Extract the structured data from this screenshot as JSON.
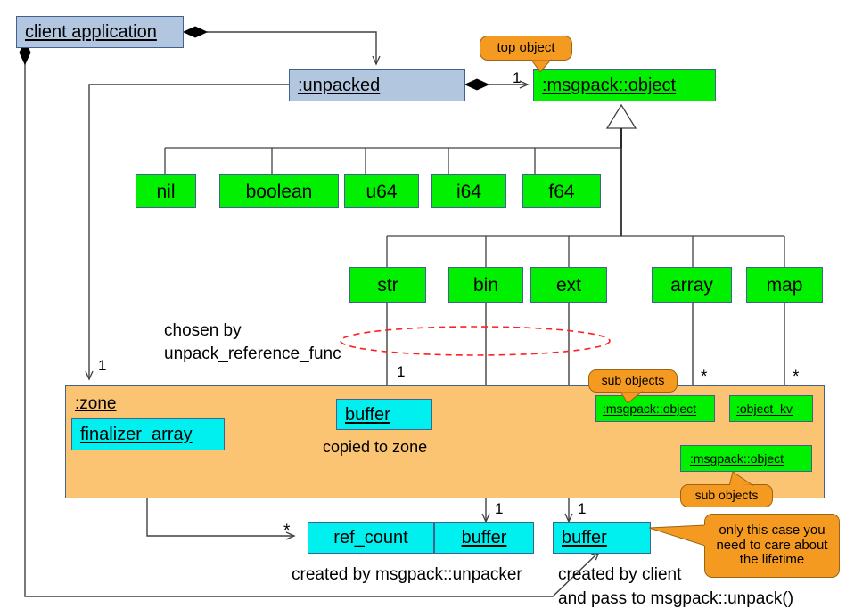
{
  "diagram": {
    "title": "msgpack unpacked object ownership diagram",
    "colors": {
      "client_box": "#b2c6e0",
      "type_box": "#00f000",
      "buffer_box": "#00f0f0",
      "zone_box": "#fac473",
      "callout": "#f59a21",
      "ellipse_hint": "#ff0000",
      "line": "#404040"
    }
  },
  "nodes": {
    "client_application": "client application",
    "unpacked": ":unpacked",
    "msgpack_object_top": ":msgpack::object",
    "zone": ":zone",
    "finalizer_array": "finalizer_array",
    "buffer_zone": "buffer",
    "sub_object": ":msgpack::object",
    "object_kv": ":object_kv",
    "kv_object": ":msgpack::object",
    "ref_count": "ref_count",
    "ref_count_buffer": "buffer",
    "client_buffer": "buffer"
  },
  "types_row1": [
    {
      "label": "nil"
    },
    {
      "label": "boolean"
    },
    {
      "label": "u64"
    },
    {
      "label": "i64"
    },
    {
      "label": "f64"
    }
  ],
  "types_row2": [
    {
      "label": "str"
    },
    {
      "label": "bin"
    },
    {
      "label": "ext"
    },
    {
      "label": "array"
    },
    {
      "label": "map"
    }
  ],
  "callouts": {
    "top_object": "top object",
    "sub_objects_left": "sub objects",
    "sub_objects_bottom": "sub objects",
    "lifetime_note": "only this case you\nneed to care about\nthe lifetime",
    "lifetime_note_l1": "only this case you",
    "lifetime_note_l2": "need to care about",
    "lifetime_note_l3": "the lifetime"
  },
  "annotations": {
    "chosen_by_l1": "chosen by",
    "chosen_by_l2": "unpack_reference_func",
    "copied_to_zone": "copied to zone",
    "created_by_unpacker": "created by msgpack::unpacker",
    "created_by_client_l1": "created by client",
    "created_by_client_l2": "and pass to msgpack::unpack()"
  },
  "multiplicities": {
    "top_object": "1",
    "zone": "1",
    "zone_buffer": "1",
    "sub_object_star": "*",
    "object_kv_star": "*",
    "ref_count_star": "*",
    "ref_count_buffer": "1",
    "client_buffer": "1"
  }
}
